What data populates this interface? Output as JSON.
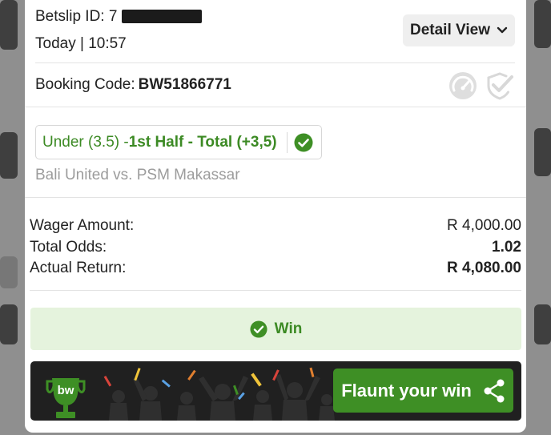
{
  "betslip": {
    "id_label": "Betslip ID:",
    "id_value_visible": "7",
    "date": "Today | 10:57",
    "detail_view_label": "Detail View",
    "booking_label": "Booking Code:",
    "booking_code": "BW51866771"
  },
  "selection": {
    "pick": "Under (3.5) - ",
    "market": "1st Half - Total (+3,5)",
    "match": "Bali United vs. PSM Makassar",
    "status_icon": "check-circle-icon"
  },
  "summary": {
    "wager_label": "Wager Amount:",
    "wager_value": "R 4,000.00",
    "odds_label": "Total Odds:",
    "odds_value": "1.02",
    "return_label": "Actual Return:",
    "return_value": "R 4,080.00"
  },
  "result": {
    "label": "Win"
  },
  "banner": {
    "logo_text": "bw",
    "button_label": "Flaunt your win"
  },
  "colors": {
    "brand_green": "#3e8f25",
    "win_bg": "#e5f3dd",
    "banner_bg": "#202020"
  }
}
